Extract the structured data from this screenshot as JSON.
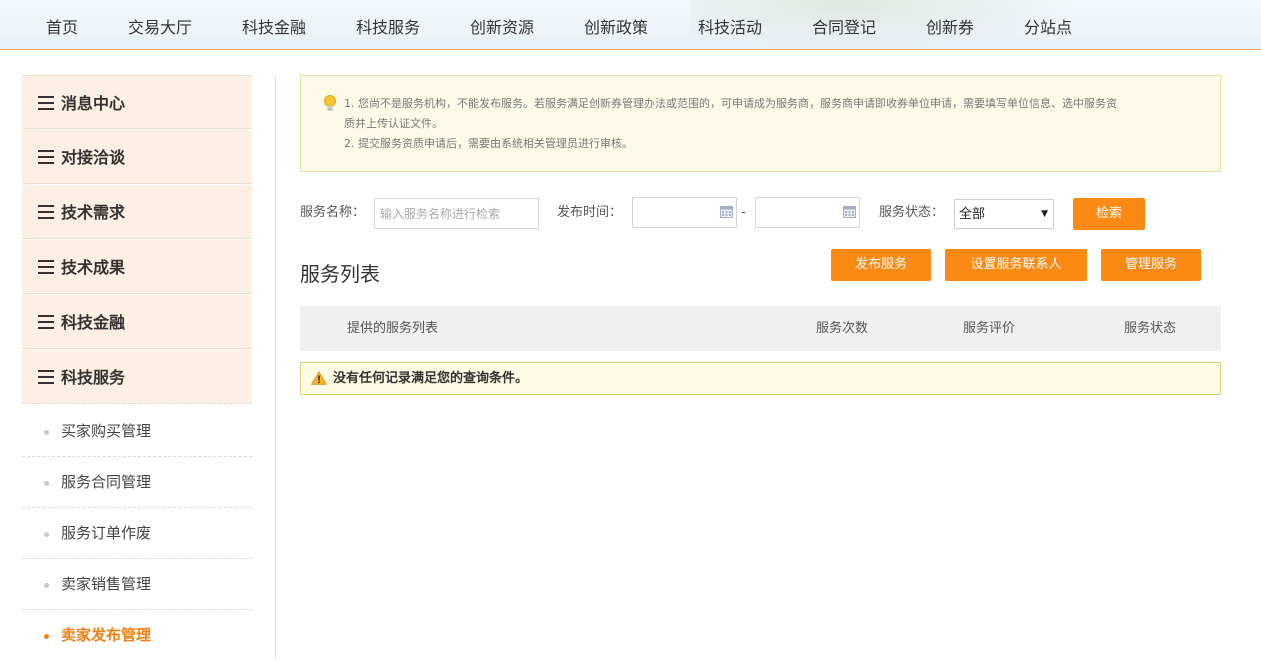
{
  "nav": {
    "items": [
      "首页",
      "交易大厅",
      "科技金融",
      "科技服务",
      "创新资源",
      "创新政策",
      "科技活动",
      "合同登记",
      "创新券",
      "分站点"
    ]
  },
  "sidebar": {
    "sections": [
      "消息中心",
      "对接洽谈",
      "技术需求",
      "技术成果",
      "科技金融",
      "科技服务"
    ],
    "sub_items": [
      "买家购买管理",
      "服务合同管理",
      "服务订单作废",
      "卖家销售管理",
      "卖家发布管理"
    ],
    "active_sub_item": "卖家发布管理"
  },
  "notice": {
    "line1": "1. 您尚不是服务机构，不能发布服务。若服务满足创新券管理办法或范围的，可申请成为服务商，服务商申请即收券单位申请，需要填写单位信息、选中服务资",
    "line1b": "质并上传认证文件。",
    "line2": "2. 提交服务资质申请后，需要由系统相关管理员进行审核。"
  },
  "search": {
    "name_label": "服务名称：",
    "name_placeholder": "输入服务名称进行检索",
    "time_label": "发布时间：",
    "date_separator": "-",
    "status_label": "服务状态：",
    "status_value": "全部",
    "search_button": "检索"
  },
  "list": {
    "title": "服务列表",
    "publish_button": "发布服务",
    "contact_button": "设置服务联系人",
    "manage_button": "管理服务",
    "columns": [
      "提供的服务列表",
      "服务次数",
      "服务评价",
      "服务状态"
    ],
    "empty_message": "没有任何记录满足您的查询条件。"
  },
  "colors": {
    "accent": "#fa8a13",
    "sidebar_bg": "#fdefe3",
    "notice_bg": "#fdfbe7"
  }
}
